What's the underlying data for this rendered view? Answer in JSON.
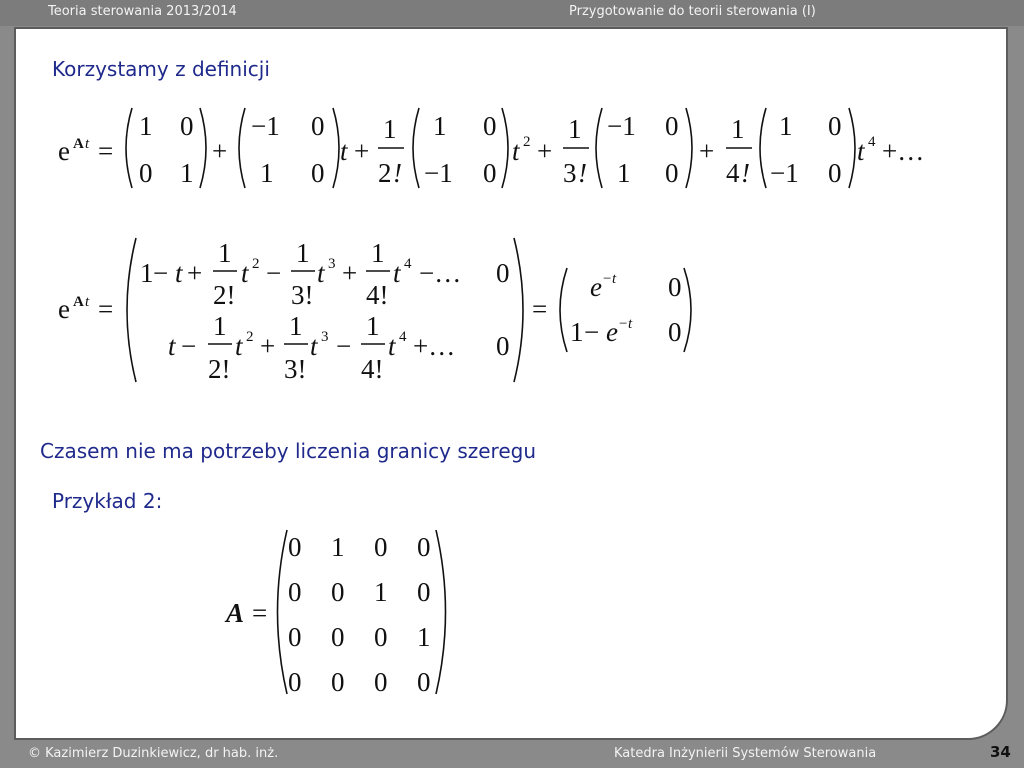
{
  "header": {
    "left": "Teoria sterowania 2013/2014",
    "right": "Przygotowanie do teorii sterowania (I)"
  },
  "footer": {
    "author": "© Kazimierz Duzinkiewicz, dr hab. inż.",
    "department": "Katedra Inżynierii Systemów Sterowania",
    "page": "34"
  },
  "content": {
    "heading1": "Korzystamy z definicji",
    "heading2": "Czasem nie ma potrzeby liczenia granicy szeregu",
    "heading3": "Przykład 2:"
  },
  "equations": {
    "eq1": "e^(At) = [[1, 0], [0, 1]] + [[−1, 0], [1, 0]] t + 1/2! [[1, 0], [−1, 0]] t^2 + 1/3! [[−1, 0], [1, 0]] t^3 + 1/4! [[1, 0], [−1, 0]] t^4 + …",
    "eq2": "e^(At) = [[1 − t + 1/2! t^2 − 1/3! t^3 + 1/4! t^4 − …, 0], [t − 1/2! t^2 + 1/3! t^3 − 1/4! t^4 + …, 0]] = [[e^(−t), 0], [1 − e^(−t), 0]]",
    "eq3": "A = [[0, 1, 0, 0], [0, 0, 1, 0], [0, 0, 0, 1], [0, 0, 0, 0]]"
  },
  "colors": {
    "heading": "#1f2a8c",
    "frame": "#8a8a8a",
    "header_text": "#f3f3f3"
  }
}
